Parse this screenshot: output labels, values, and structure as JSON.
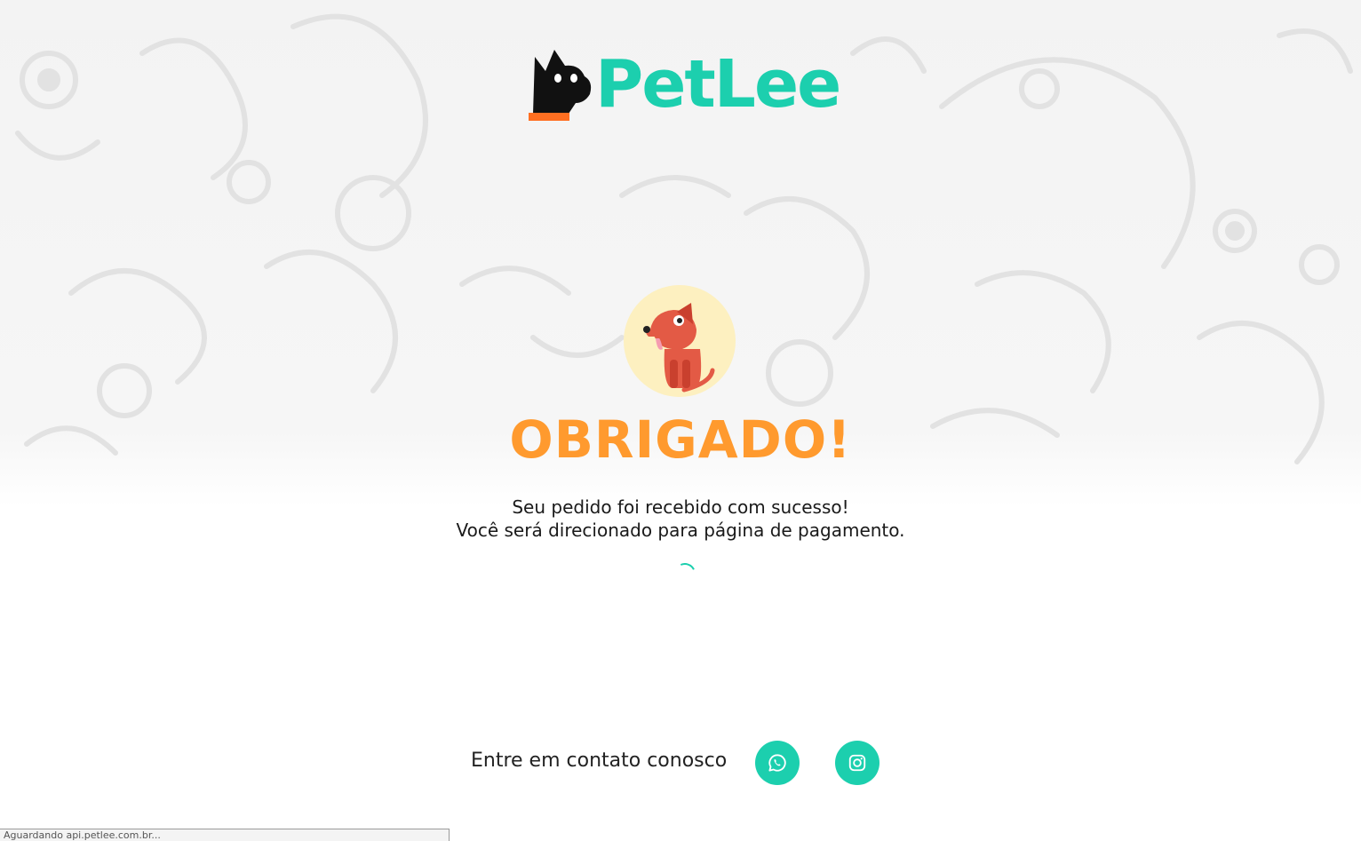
{
  "brand": {
    "name": "PetLee",
    "colors": {
      "teal": "#1ccfae",
      "orange": "#ff9a2e",
      "dark": "#111111",
      "collar": "#ff6f21",
      "badge_bg": "#fdf0c0",
      "dog_red": "#e35a45"
    }
  },
  "confirmation": {
    "headline": "OBRIGADO!",
    "line1": "Seu pedido foi recebido com sucesso!",
    "line2": "Você será direcionado para página de pagamento."
  },
  "contact": {
    "label": "Entre em contato conosco",
    "whatsapp_icon": "whatsapp-icon",
    "instagram_icon": "instagram-icon"
  },
  "status_bar": {
    "text": "Aguardando api.petlee.com.br..."
  }
}
